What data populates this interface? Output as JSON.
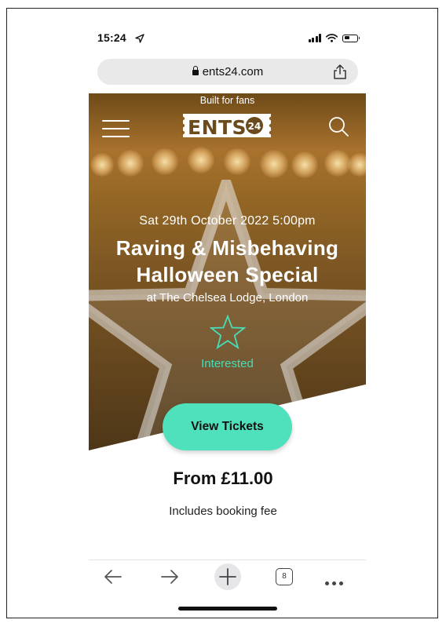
{
  "status_bar": {
    "time": "15:24"
  },
  "browser": {
    "url": "ents24.com",
    "tab_count": "8"
  },
  "site": {
    "tagline": "Built for fans",
    "logo_text": "ENTS 24"
  },
  "event": {
    "date": "Sat 29th October 2022 5:00pm",
    "title_line1": "Raving & Misbehaving",
    "title_line2": "Halloween Special",
    "venue": "at The Chelsea Lodge, London",
    "interested_label": "Interested",
    "cta_label": "View Tickets",
    "price": "From £11.00",
    "fee_note": "Includes booking fee"
  },
  "colors": {
    "accent": "#4fe0bc",
    "interested": "#48ddb9"
  }
}
